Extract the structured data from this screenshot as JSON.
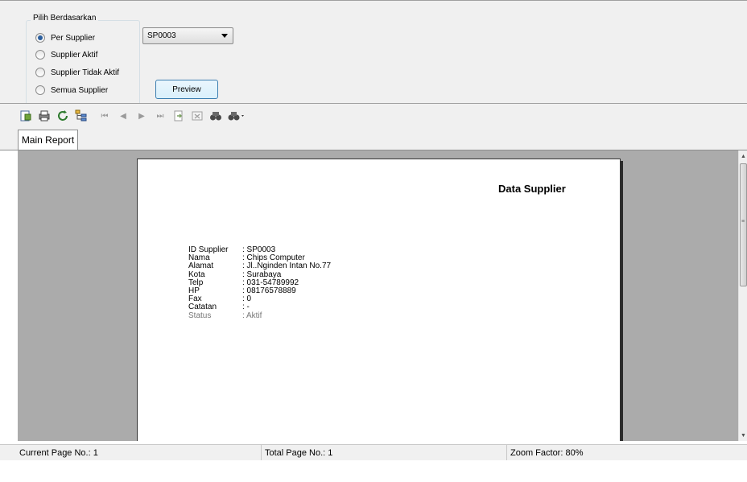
{
  "filter": {
    "group_title": "Pilih Berdasarkan",
    "options": [
      {
        "label": "Per Supplier",
        "checked": true
      },
      {
        "label": "Supplier Aktif",
        "checked": false
      },
      {
        "label": "Supplier Tidak Aktif",
        "checked": false
      },
      {
        "label": "Semua Supplier",
        "checked": false
      }
    ],
    "supplier_select": {
      "value": "SP0003"
    },
    "preview_label": "Preview"
  },
  "toolbar": {
    "icons": [
      "export-icon",
      "print-icon",
      "refresh-icon",
      "group-tree-icon",
      "first-page-icon",
      "previous-page-icon",
      "next-page-icon",
      "last-page-icon",
      "goto-page-icon",
      "close-view-icon",
      "find-icon",
      "zoom-icon"
    ]
  },
  "tabs": [
    {
      "label": "Main Report"
    }
  ],
  "report": {
    "title": "Data Supplier",
    "fields": [
      {
        "label": "ID Supplier",
        "value": ": SP0003"
      },
      {
        "label": "Nama",
        "value": ": Chips Computer"
      },
      {
        "label": "Alamat",
        "value": ": Jl..Nginden Intan No.77"
      },
      {
        "label": "Kota",
        "value": ": Surabaya"
      },
      {
        "label": "Telp",
        "value": ": 031-54789992"
      },
      {
        "label": "HP",
        "value": ": 08176578889"
      },
      {
        "label": "Fax",
        "value": ": 0"
      },
      {
        "label": "Catatan",
        "value": ": -"
      },
      {
        "label": "Status",
        "value": ": Aktif"
      }
    ]
  },
  "statusbar": {
    "current_page": "Current Page No.: 1",
    "total_page": "Total Page No.: 1",
    "zoom": "Zoom Factor: 80%"
  }
}
